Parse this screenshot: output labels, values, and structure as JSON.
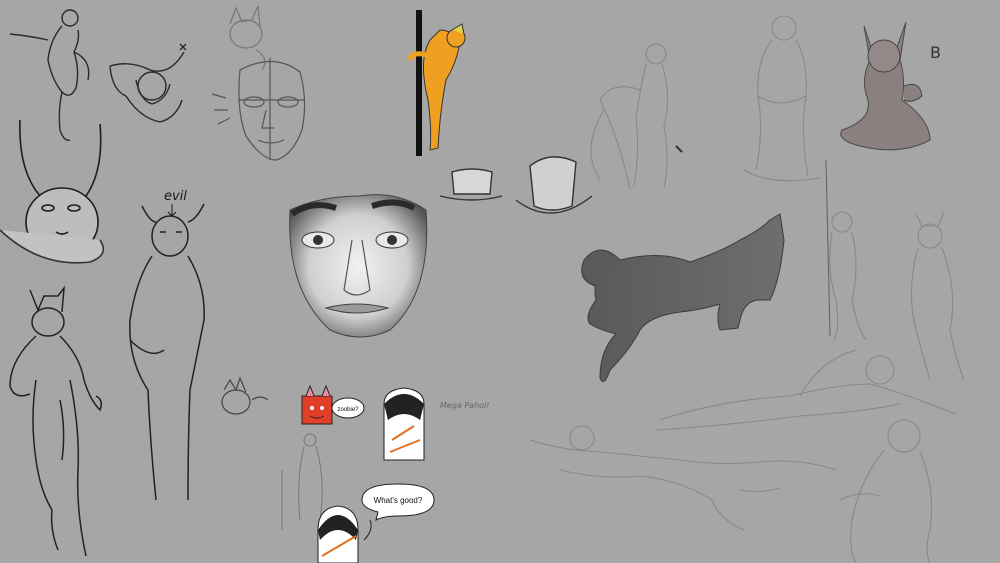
{
  "canvas": {
    "background": "#a6a6a6"
  },
  "annotations": {
    "evil": "evil",
    "zoobie": "zoobie?",
    "whats_good": "What's good?",
    "mega_pahol": "Mega Pahol!",
    "heart": "B"
  },
  "colors": {
    "ink": "#2a2a2a",
    "light_sketch": "#8a8a8a",
    "orange_figure": "#f0a020",
    "character_red": "#e0402a",
    "character_pink": "#f08aa0"
  }
}
